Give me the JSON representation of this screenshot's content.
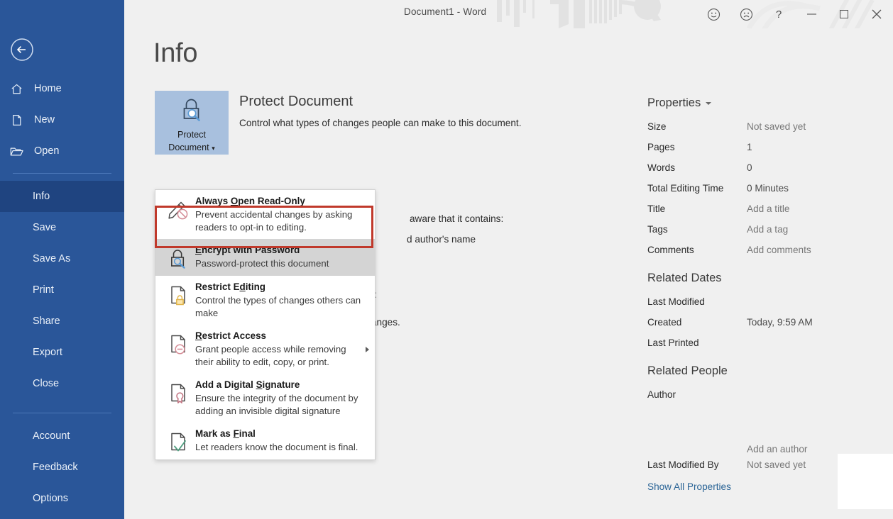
{
  "window": {
    "title": "Document1  -  Word",
    "controls": [
      {
        "name": "smiley-feedback-icon",
        "glyph": "smile"
      },
      {
        "name": "frown-feedback-icon",
        "glyph": "frown"
      },
      {
        "name": "help-icon",
        "label": "?"
      },
      {
        "name": "minimize-button",
        "glyph": "minimize"
      },
      {
        "name": "maximize-button",
        "glyph": "maximize"
      },
      {
        "name": "close-button",
        "glyph": "close"
      }
    ]
  },
  "sidebar": {
    "back_label": "Back",
    "items": [
      {
        "label": "Home",
        "icon": "home-icon",
        "selected": false
      },
      {
        "label": "New",
        "icon": "new-document-icon",
        "selected": false
      },
      {
        "label": "Open",
        "icon": "open-folder-icon",
        "selected": false
      },
      {
        "label": "Info",
        "icon": null,
        "selected": true
      },
      {
        "label": "Save",
        "icon": null,
        "selected": false
      },
      {
        "label": "Save As",
        "icon": null,
        "selected": false
      },
      {
        "label": "Print",
        "icon": null,
        "selected": false
      },
      {
        "label": "Share",
        "icon": null,
        "selected": false
      },
      {
        "label": "Export",
        "icon": null,
        "selected": false
      },
      {
        "label": "Close",
        "icon": null,
        "selected": false
      },
      {
        "label": "Account",
        "icon": null,
        "selected": false
      },
      {
        "label": "Feedback",
        "icon": null,
        "selected": false
      },
      {
        "label": "Options",
        "icon": null,
        "selected": false
      }
    ]
  },
  "page": {
    "title": "Info"
  },
  "protect_document": {
    "tile_line1": "Protect",
    "tile_line2": "Document",
    "heading": "Protect Document",
    "description": "Control what types of changes people can make to this document."
  },
  "occluded_text": {
    "line1": "aware that it contains:",
    "line2": "d author's name",
    "line3": ":",
    "line4": "anges."
  },
  "menu": {
    "items": [
      {
        "title_pre": "Always ",
        "title_key": "O",
        "title_post": "pen Read-Only",
        "desc": "Prevent accidental changes by asking readers to opt-in to editing.",
        "icon": "pencil-no-entry-icon",
        "highlighted": false,
        "submenu": false
      },
      {
        "title_pre": "",
        "title_key": "E",
        "title_post": "ncrypt with Password",
        "desc": "Password-protect this document",
        "icon": "lock-key-icon",
        "highlighted": true,
        "submenu": false
      },
      {
        "title_pre": "Restrict E",
        "title_key": "d",
        "title_post": "iting",
        "desc": "Control the types of changes others can make",
        "icon": "document-padlock-icon",
        "highlighted": false,
        "submenu": false
      },
      {
        "title_pre": "",
        "title_key": "R",
        "title_post": "estrict Access",
        "desc": "Grant people access while removing their ability to edit, copy, or print.",
        "icon": "document-minus-icon",
        "highlighted": false,
        "submenu": true
      },
      {
        "title_pre": "Add a Digital ",
        "title_key": "S",
        "title_post": "ignature",
        "desc": "Ensure the integrity of the document by adding an invisible digital signature",
        "icon": "document-signature-icon",
        "highlighted": false,
        "submenu": false
      },
      {
        "title_pre": "Mark as ",
        "title_key": "F",
        "title_post": "inal",
        "desc": "Let readers know the document is final.",
        "icon": "document-check-icon",
        "highlighted": false,
        "submenu": false
      }
    ]
  },
  "properties": {
    "heading": "Properties",
    "rows": [
      {
        "key": "Size",
        "value": "Not saved yet",
        "filled": false
      },
      {
        "key": "Pages",
        "value": "1",
        "filled": true
      },
      {
        "key": "Words",
        "value": "0",
        "filled": true
      },
      {
        "key": "Total Editing Time",
        "value": "0 Minutes",
        "filled": true
      },
      {
        "key": "Title",
        "value": "Add a title",
        "filled": false
      },
      {
        "key": "Tags",
        "value": "Add a tag",
        "filled": false
      },
      {
        "key": "Comments",
        "value": "Add comments",
        "filled": false
      }
    ]
  },
  "related_dates": {
    "heading": "Related Dates",
    "rows": [
      {
        "key": "Last Modified",
        "value": "",
        "filled": false
      },
      {
        "key": "Created",
        "value": "Today, 9:59 AM",
        "filled": true
      },
      {
        "key": "Last Printed",
        "value": "",
        "filled": false
      }
    ]
  },
  "related_people": {
    "heading": "Related People",
    "rows": [
      {
        "key": "Author",
        "value": "",
        "filled": false
      },
      {
        "key": "",
        "value": "Add an author",
        "filled": false
      },
      {
        "key": "Last Modified By",
        "value": "Not saved yet",
        "filled": false
      }
    ],
    "show_all": "Show All Properties"
  },
  "colors": {
    "sidebar_blue": "#2a5699",
    "sidebar_selected": "#1f4480",
    "tile_blue": "#a8c0de",
    "highlight_ring": "#c0392b",
    "menu_highlight": "#d4d4d4",
    "link_blue": "#2a6496"
  }
}
